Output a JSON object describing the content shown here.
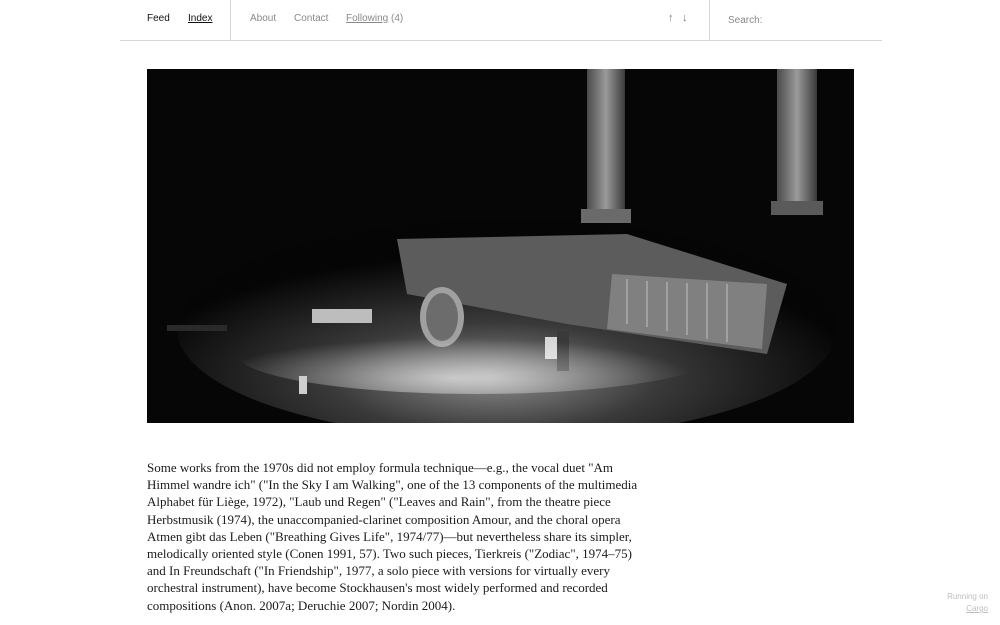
{
  "nav": {
    "feed": "Feed",
    "index": "Index",
    "about": "About",
    "contact": "Contact",
    "following_label": "Following",
    "following_count": "(4)",
    "up_arrow": "↑",
    "down_arrow": "↓",
    "search_placeholder": "Search:"
  },
  "post": {
    "image_icon": "concert-photo",
    "text": "Some works from the 1970s did not employ formula technique—e.g., the vocal duet \"Am Himmel wandre ich\" (\"In the Sky I am Walking\", one of the 13 components of the multimedia Alphabet für Liège, 1972), \"Laub und Regen\" (\"Leaves and Rain\", from the theatre piece Herbstmusik (1974), the unaccompanied-clarinet composition Amour, and the choral opera Atmen gibt das Leben (\"Breathing Gives Life\", 1974/77)—but nevertheless share its simpler, melodically oriented style (Conen 1991, 57). Two such pieces, Tierkreis (\"Zodiac\", 1974–75) and In Freundschaft (\"In Friendship\", 1977, a solo piece with versions for virtually every orchestral instrument), have become Stockhausen's most widely performed and recorded compositions (Anon. 2007a; Deruchie 2007; Nordin 2004)."
  },
  "footer": {
    "running_on": "Running on",
    "cargo": "Cargo"
  }
}
